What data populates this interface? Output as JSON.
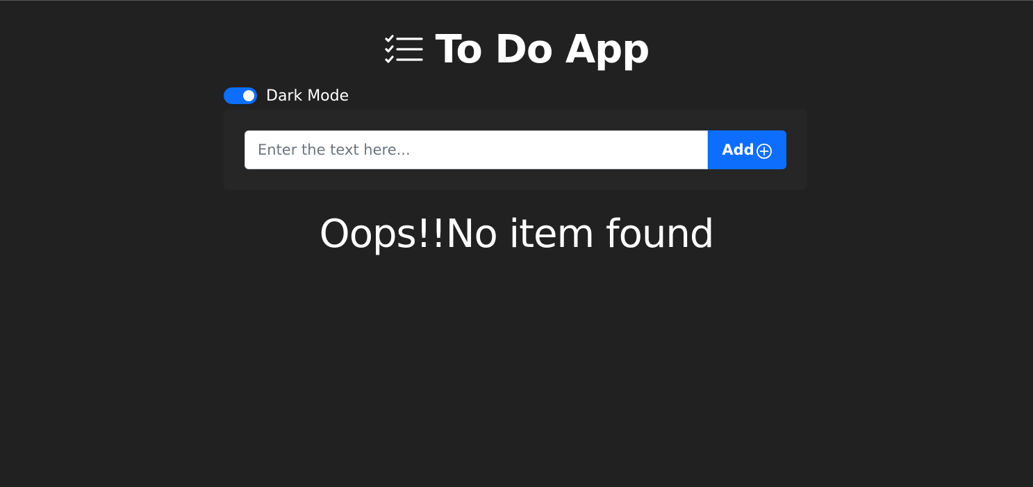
{
  "header": {
    "title": "To Do App",
    "icon": "checklist-icon"
  },
  "theme_toggle": {
    "label": "Dark Mode",
    "checked": true
  },
  "todo_form": {
    "input": {
      "value": "",
      "placeholder": "Enter the text here..."
    },
    "add_button": {
      "label": "Add",
      "icon": "plus-circle-icon"
    }
  },
  "empty_state": {
    "message": "Oops!!No item found"
  },
  "colors": {
    "background": "#212121",
    "card": "#262626",
    "accent": "#0d6efd",
    "text": "#ffffff"
  }
}
